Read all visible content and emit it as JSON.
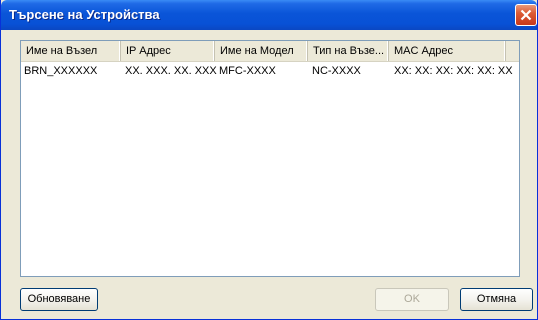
{
  "window": {
    "title": "Търсене на Устройства"
  },
  "columns": [
    "Име на Възел",
    "IP Адрес",
    "Име на Модел",
    "Тип на Възе...",
    "MAC Адрес"
  ],
  "rows": [
    [
      "BRN_XXXXXX",
      "XX. XXX. XX. XXX",
      "MFC-XXXX",
      "NC-XXXX",
      "XX: XX: XX: XX: XX: XX"
    ]
  ],
  "buttons": {
    "refresh": "Обновяване",
    "ok": "OK",
    "cancel": "Отмяна"
  },
  "icons": {
    "close": "close-icon"
  },
  "colors": {
    "titlebar": "#0a55d8",
    "close": "#c8381b",
    "window_bg": "#ece9d8"
  }
}
